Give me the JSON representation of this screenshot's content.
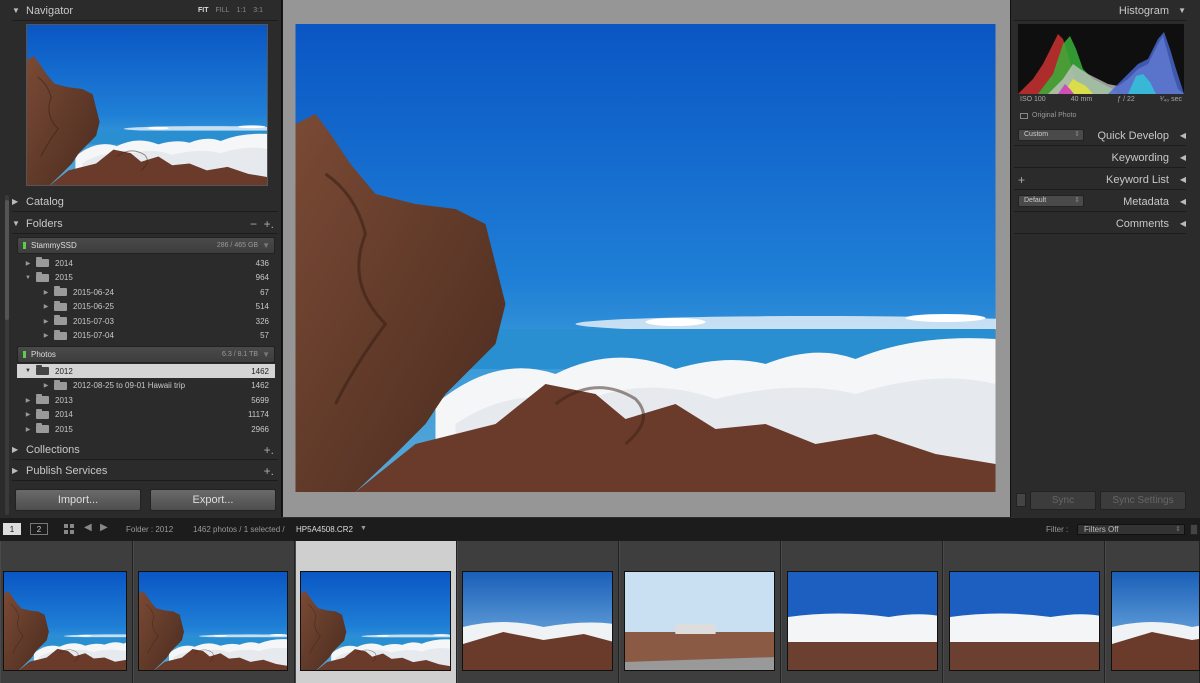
{
  "navigator": {
    "title": "Navigator",
    "modes": [
      "FIT",
      "FILL",
      "1:1",
      "3:1"
    ],
    "active_mode": "FIT"
  },
  "left_panels": {
    "catalog": "Catalog",
    "folders": "Folders",
    "collections": "Collections",
    "publish": "Publish Services"
  },
  "volumes": [
    {
      "name": "StammySSD",
      "size": "286 / 465 GB"
    },
    {
      "name": "Photos",
      "size": "6.3 / 8.1 TB"
    }
  ],
  "folders_ssd": [
    {
      "name": "2014",
      "count": "436",
      "level": 0,
      "expanded": false
    },
    {
      "name": "2015",
      "count": "964",
      "level": 0,
      "expanded": true
    },
    {
      "name": "2015-06-24",
      "count": "67",
      "level": 1,
      "expanded": false
    },
    {
      "name": "2015-06-25",
      "count": "514",
      "level": 1,
      "expanded": false
    },
    {
      "name": "2015-07-03",
      "count": "326",
      "level": 1,
      "expanded": false
    },
    {
      "name": "2015-07-04",
      "count": "57",
      "level": 1,
      "expanded": false
    }
  ],
  "folders_photos": [
    {
      "name": "2012",
      "count": "1462",
      "level": 0,
      "expanded": true,
      "selected": true
    },
    {
      "name": "2012-08-25 to 09-01 Hawaii trip",
      "count": "1462",
      "level": 1,
      "expanded": false
    },
    {
      "name": "2013",
      "count": "5699",
      "level": 0,
      "expanded": false
    },
    {
      "name": "2014",
      "count": "11174",
      "level": 0,
      "expanded": false
    },
    {
      "name": "2015",
      "count": "2966",
      "level": 0,
      "expanded": false
    }
  ],
  "buttons": {
    "import": "Import...",
    "export": "Export...",
    "sync": "Sync",
    "sync_settings": "Sync Settings"
  },
  "right_panels": {
    "histogram": "Histogram",
    "quick_develop": "Quick Develop",
    "quick_develop_preset": "Custom",
    "keywording": "Keywording",
    "keyword_list": "Keyword List",
    "metadata": "Metadata",
    "metadata_preset": "Default",
    "comments": "Comments"
  },
  "exif": {
    "iso": "ISO 100",
    "focal": "40 mm",
    "aperture": "ƒ / 22",
    "shutter": "¹⁄₄₀ sec",
    "original": "Original Photo"
  },
  "toolbar": {
    "screen1": "1",
    "screen2": "2",
    "folder": "Folder : 2012",
    "count": "1462 photos / 1 selected /",
    "filename": "HP5A4508.CR2",
    "filter_label": "Filter :",
    "filter_value": "Filters Off"
  },
  "colors": {
    "panel": "#2b2b2b",
    "center": "#969696",
    "selected": "#d4d4d4",
    "led": "#5ccd48"
  }
}
